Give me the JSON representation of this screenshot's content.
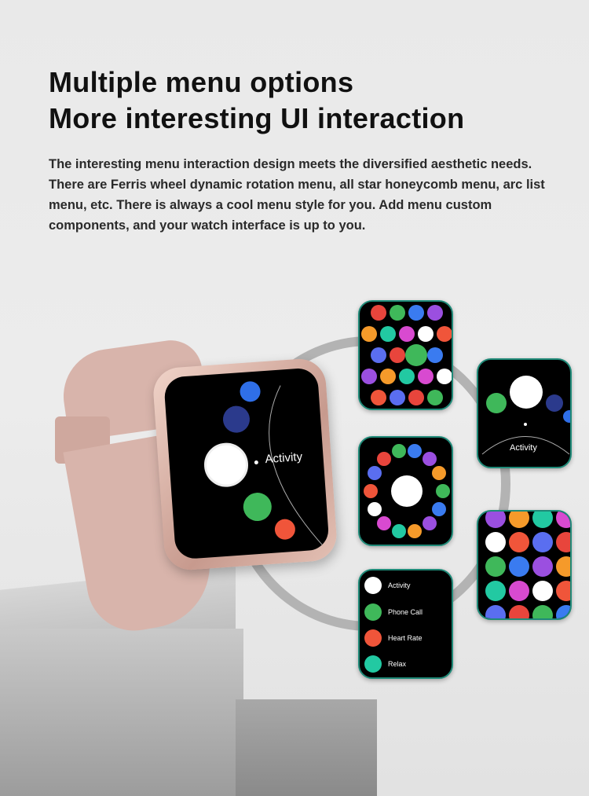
{
  "heading": {
    "line1": "Multiple menu options",
    "line2": "More interesting UI interaction"
  },
  "description": "The interesting menu interaction design meets the diversified aesthetic needs. There are Ferris wheel dynamic rotation menu, all star honeycomb menu, arc list menu, etc. There is always a cool menu style for you. Add menu custom components, and your watch interface is up to you.",
  "watch": {
    "focused_app": "Activity",
    "icons": [
      "calculator-icon",
      "settings-icon",
      "activity-icon",
      "phone-icon",
      "heart-rate-icon"
    ]
  },
  "screens": {
    "arc": {
      "label": "Activity"
    },
    "list": {
      "items": [
        {
          "label": "Activity",
          "icon": "activity-icon",
          "color": "#ffffff"
        },
        {
          "label": "Phone Call",
          "icon": "phone-icon",
          "color": "#3fb85a"
        },
        {
          "label": "Heart Rate",
          "icon": "heart-rate-icon",
          "color": "#f0553a"
        },
        {
          "label": "Relax",
          "icon": "relax-icon",
          "color": "#22c9a2"
        }
      ]
    }
  },
  "colors": {
    "band": "#d8b4ab",
    "screen_border": "#1f8a78",
    "icon_palette": [
      "#e8453c",
      "#3fb85a",
      "#3a7bf0",
      "#9b4fe0",
      "#f59a2a",
      "#22c9a2",
      "#d84ad0",
      "#ffffff",
      "#f0553a",
      "#5a6ef0"
    ]
  }
}
